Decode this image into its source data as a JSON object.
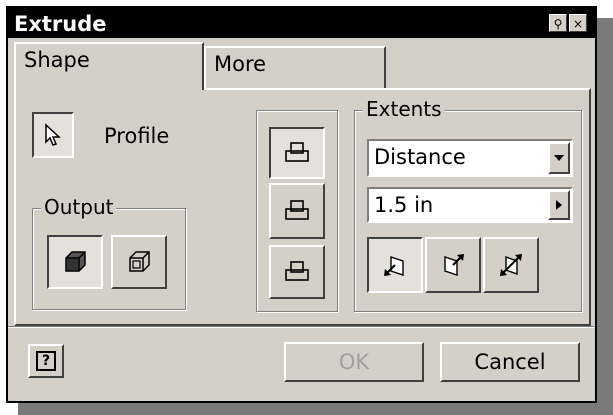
{
  "window": {
    "title": "Extrude",
    "pin_button": "⚲",
    "close_button": "×"
  },
  "tabs": [
    {
      "label": "Shape",
      "active": true
    },
    {
      "label": "More",
      "active": false
    }
  ],
  "shape": {
    "profile_label": "Profile",
    "output_legend": "Output",
    "output_options": [
      {
        "name": "solid",
        "icon": "solid-box-icon",
        "selected": true
      },
      {
        "name": "surface",
        "icon": "surface-box-icon",
        "selected": false
      }
    ],
    "operations": [
      {
        "name": "join",
        "icon": "join-icon",
        "selected": true
      },
      {
        "name": "cut",
        "icon": "cut-icon",
        "selected": false
      },
      {
        "name": "intersect",
        "icon": "intersect-icon",
        "selected": false
      }
    ],
    "extents": {
      "legend": "Extents",
      "type_value": "Distance",
      "distance_value": "1.5 in",
      "directions": [
        {
          "name": "direction-1",
          "icon": "direction-one-icon",
          "selected": true
        },
        {
          "name": "direction-2",
          "icon": "direction-two-icon",
          "selected": false
        },
        {
          "name": "symmetric",
          "icon": "symmetric-icon",
          "selected": false
        }
      ]
    }
  },
  "footer": {
    "help_icon": "?",
    "ok_label": "OK",
    "ok_enabled": false,
    "cancel_label": "Cancel"
  },
  "colors": {
    "face": "#d4d0c8",
    "titlebar": "#000000",
    "disabled_text": "#a0a0a0"
  }
}
